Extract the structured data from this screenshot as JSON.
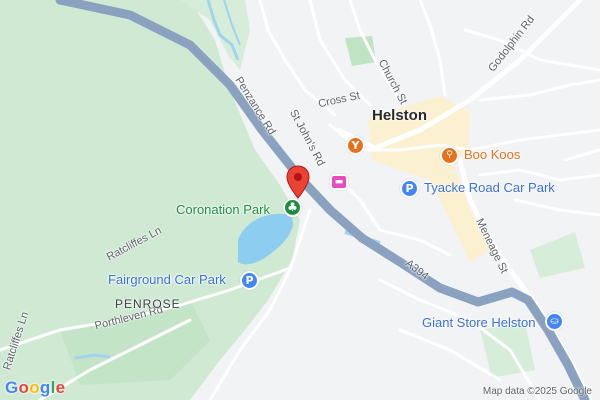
{
  "map": {
    "colors": {
      "land": "#f1f3f4",
      "green": "#c8e6c9",
      "water": "#9fd3f0",
      "major_road": "#8aa1bf",
      "road": "#ffffff",
      "town_center": "#fbf3d7",
      "poi_orange": "#e8711c",
      "poi_green": "#1e8e3e",
      "poi_blue": "#4285f4",
      "poi_pink": "#e94bbf",
      "pin_red": "#ea4335"
    },
    "places": {
      "town": "Helston",
      "district": "PENROSE"
    },
    "streets": {
      "penzance_rd": "Penzance Rd",
      "st_johns_rd": "St John's Rd",
      "cross_st": "Cross St",
      "church_st": "Church St",
      "godolphin_rd": "Godolphin Rd",
      "ratcliffes_ln_1": "Ratcliffes Ln",
      "ratcliffes_ln_2": "Ratcliffes Ln",
      "porthleven_rd": "Porthleven Rd",
      "meneage_st": "Meneage St",
      "a394": "A394"
    },
    "pois": [
      {
        "label": "Boo Koos",
        "icon": "restaurant-icon",
        "glyph": "🍴",
        "color": "#e8711c"
      },
      {
        "label": "Tyacke Road Car Park",
        "icon": "parking-icon",
        "glyph": "P",
        "color": "#4285f4"
      },
      {
        "label": "Coronation Park",
        "icon": "park-tree-icon",
        "glyph": "♣",
        "color": "#1e8e3e"
      },
      {
        "label": "Fairground Car Park",
        "icon": "parking-icon",
        "glyph": "P",
        "color": "#4285f4"
      },
      {
        "label": "Giant Store Helston",
        "icon": "shopping-bag-icon",
        "glyph": "⛀",
        "color": "#4285f4"
      },
      {
        "label": "",
        "icon": "bar-cocktail-icon",
        "glyph": "Y",
        "color": "#e8711c"
      },
      {
        "label": "",
        "icon": "hotel-bed-icon",
        "glyph": "▬",
        "color": "#e94bbf"
      }
    ],
    "logo": "Google",
    "attribution": "Map data ©2025 Google"
  }
}
